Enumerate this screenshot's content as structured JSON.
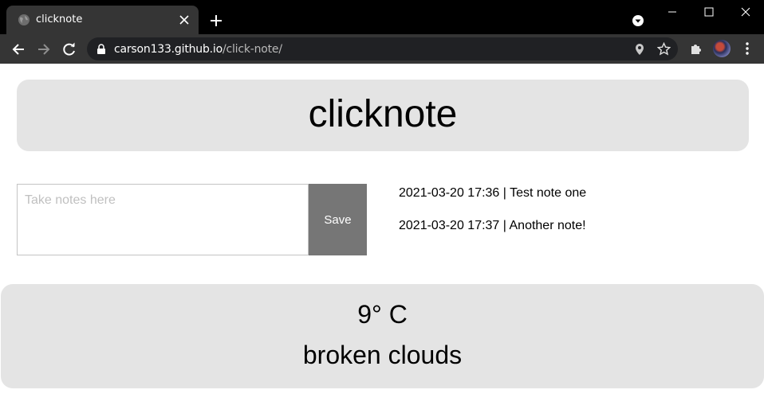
{
  "browser": {
    "tab_title": "clicknote",
    "url_host": "carson133.github.io",
    "url_path": "/click-note/"
  },
  "app": {
    "title": "clicknote",
    "note_input": {
      "placeholder": "Take notes here",
      "value": ""
    },
    "save_label": "Save",
    "notes": [
      {
        "text": "2021-03-20 17:36 | Test note one"
      },
      {
        "text": "2021-03-20 17:37 | Another note!"
      }
    ],
    "weather": {
      "temperature": "9° C",
      "description": "broken clouds"
    }
  },
  "colors": {
    "box_background": "#e4e4e4",
    "save_button": "#767676",
    "chrome_dark": "#353535"
  }
}
